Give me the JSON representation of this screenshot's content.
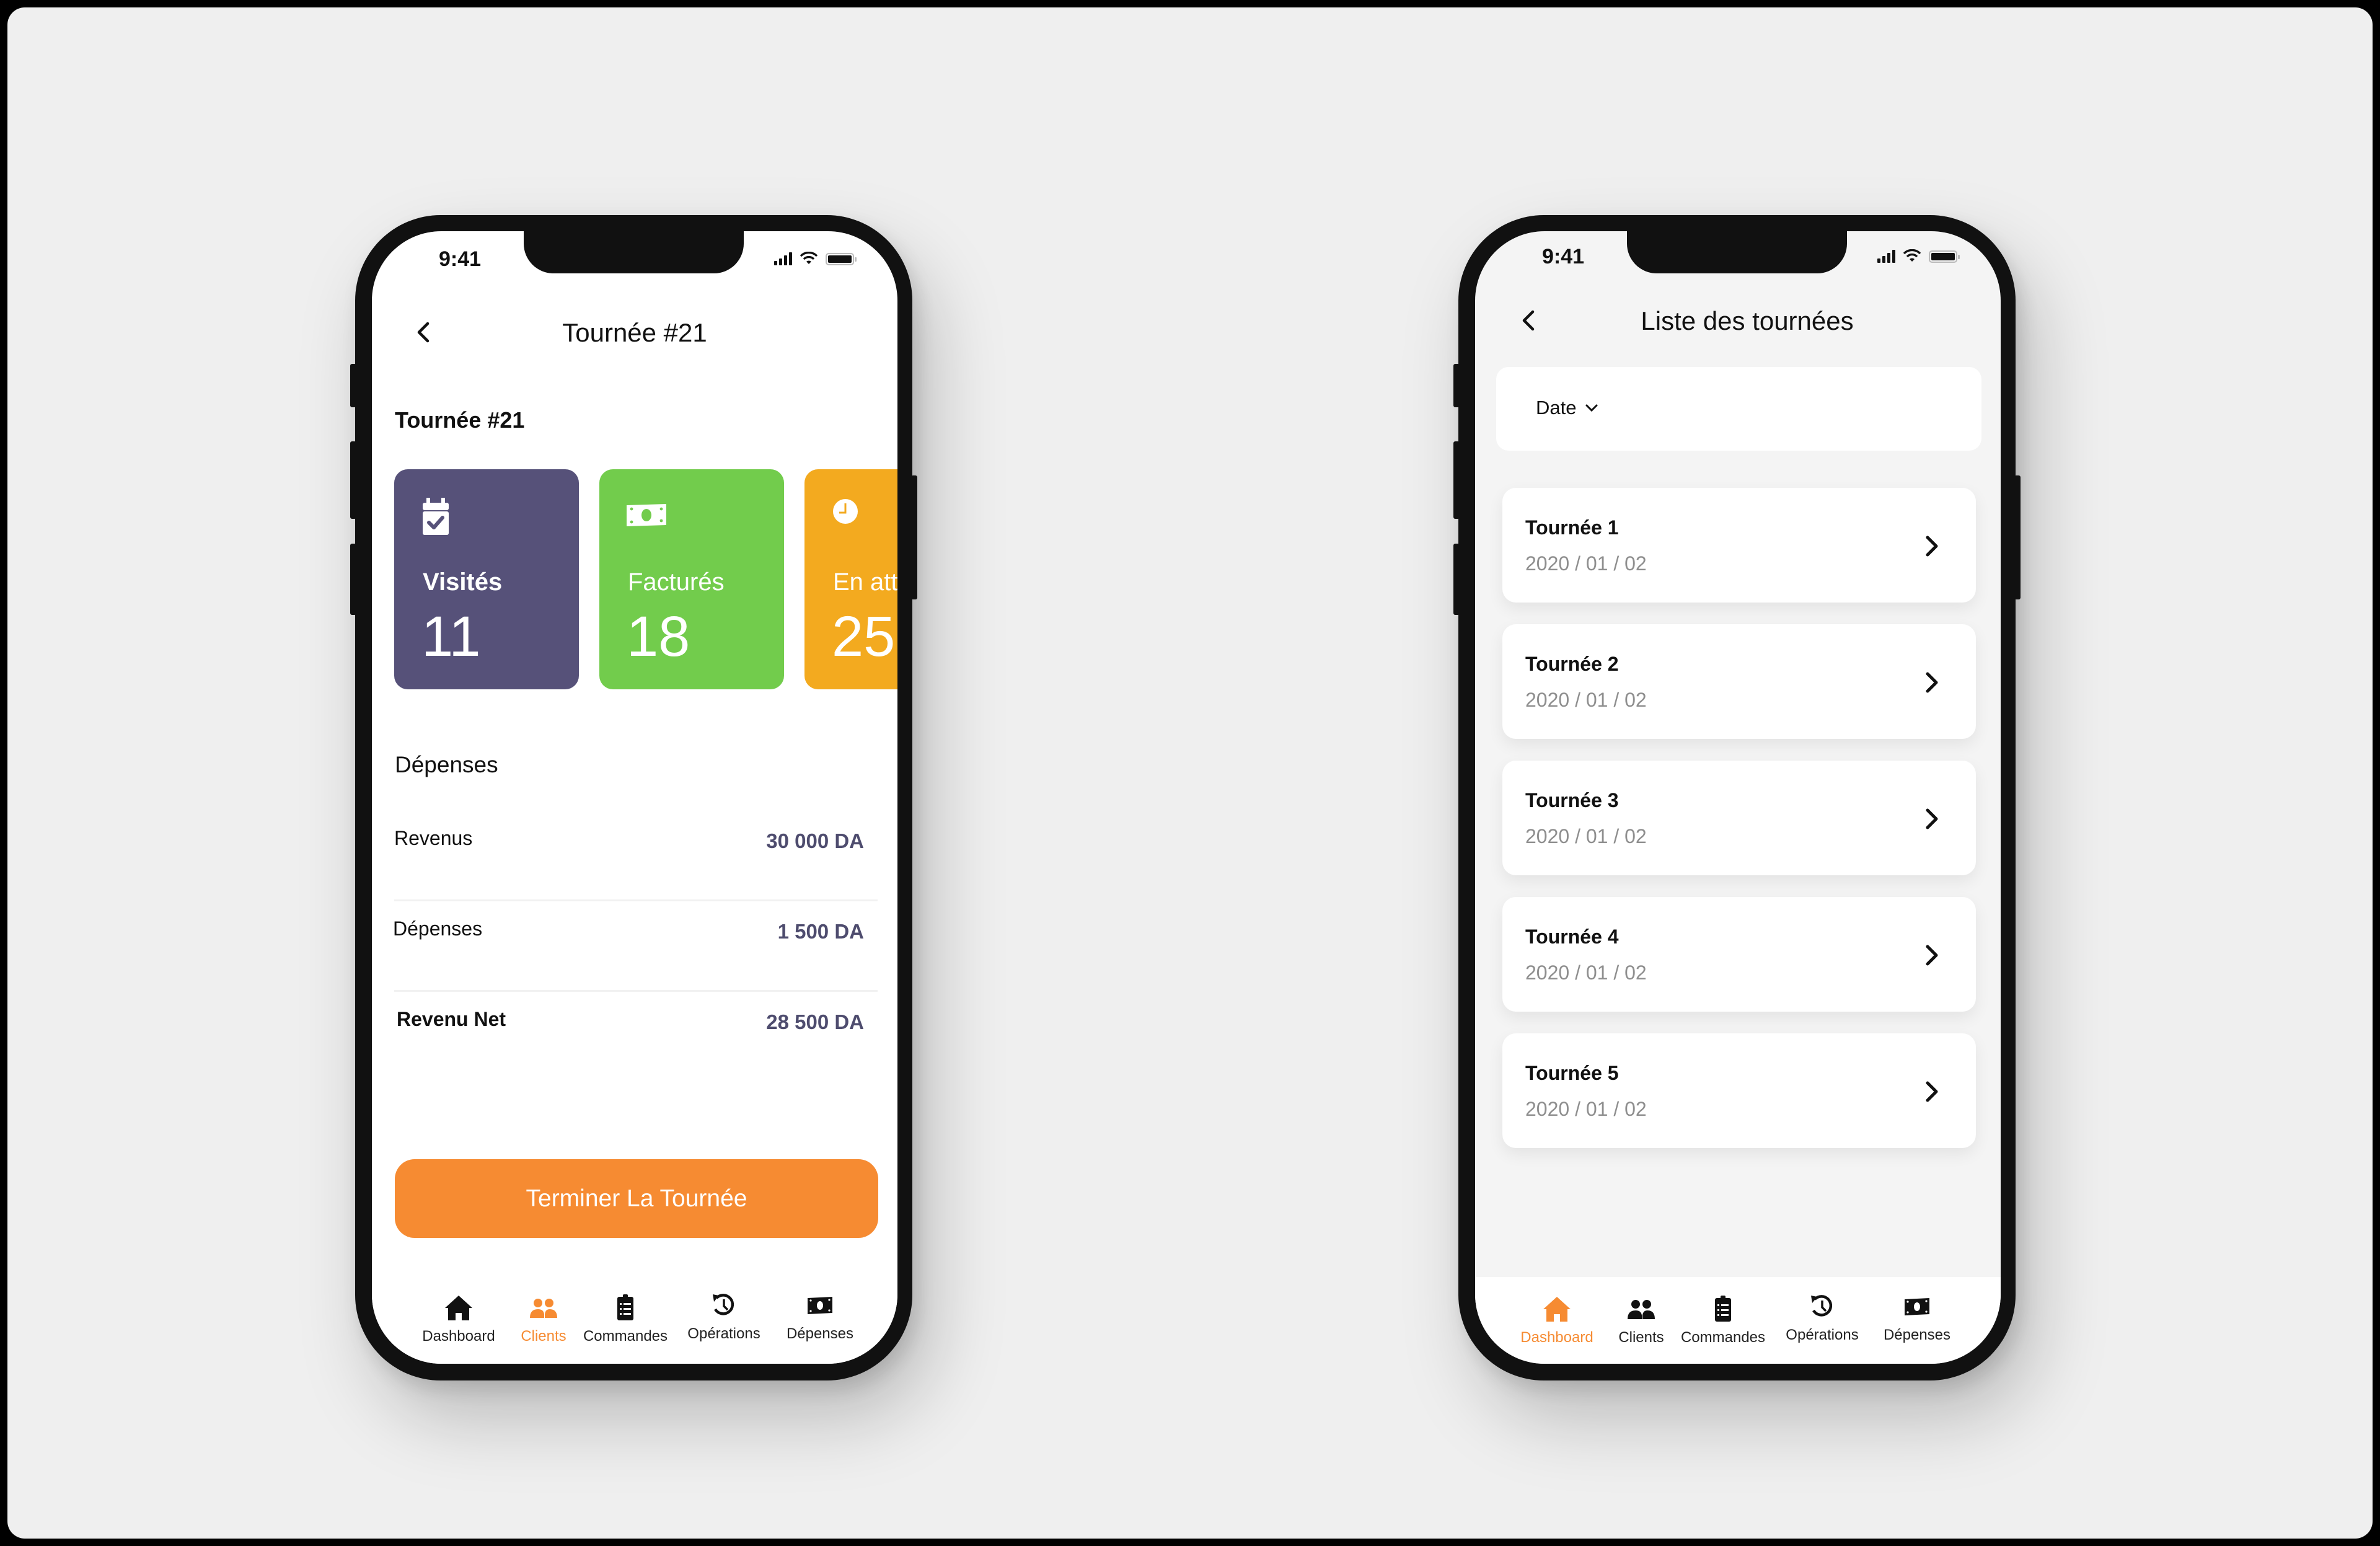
{
  "left_screen": {
    "status_time": "9:41",
    "header_title": "Tournée #21",
    "subheading": "Tournée #21",
    "stats": [
      {
        "label": "Visités",
        "value": "11",
        "icon": "calendar-check-icon",
        "color": "#565179"
      },
      {
        "label": "Facturés",
        "value": "18",
        "icon": "money-bill-icon",
        "color": "#72cc4c"
      },
      {
        "label": "En attente",
        "value": "25",
        "icon": "clock-icon",
        "color": "#f3aa1f"
      }
    ],
    "section_title": "Dépenses",
    "rows": [
      {
        "label": "Revenus",
        "value": "30 000 DA"
      },
      {
        "label": "Dépenses",
        "value": "1 500 DA"
      },
      {
        "label": "Revenu Net",
        "value": "28 500 DA"
      }
    ],
    "cta_label": "Terminer La Tournée",
    "nav": [
      {
        "label": "Dashboard",
        "icon": "home-icon",
        "active": false
      },
      {
        "label": "Clients",
        "icon": "users-icon",
        "active": true
      },
      {
        "label": "Commandes",
        "icon": "clipboard-list-icon",
        "active": false
      },
      {
        "label": "Opérations",
        "icon": "history-icon",
        "active": false
      },
      {
        "label": "Dépenses",
        "icon": "money-bill-icon",
        "active": false
      }
    ]
  },
  "right_screen": {
    "status_time": "9:41",
    "header_title": "Liste des tournées",
    "filter_label": "Date",
    "items": [
      {
        "title": "Tournée 1",
        "date": "2020 / 01 / 02"
      },
      {
        "title": "Tournée 2",
        "date": "2020 / 01 / 02"
      },
      {
        "title": "Tournée 3",
        "date": "2020 / 01 / 02"
      },
      {
        "title": "Tournée 4",
        "date": "2020 / 01 / 02"
      },
      {
        "title": "Tournée 5",
        "date": "2020 / 01 / 02"
      }
    ],
    "nav": [
      {
        "label": "Dashboard",
        "icon": "home-icon",
        "active": true
      },
      {
        "label": "Clients",
        "icon": "users-icon",
        "active": false
      },
      {
        "label": "Commandes",
        "icon": "clipboard-list-icon",
        "active": false
      },
      {
        "label": "Opérations",
        "icon": "history-icon",
        "active": false
      },
      {
        "label": "Dépenses",
        "icon": "money-bill-icon",
        "active": false
      }
    ]
  },
  "colors": {
    "accent": "#f68b32",
    "amount_text": "#4e4c6e",
    "date_text": "#8e8e8e",
    "page_bg": "#efefef"
  }
}
